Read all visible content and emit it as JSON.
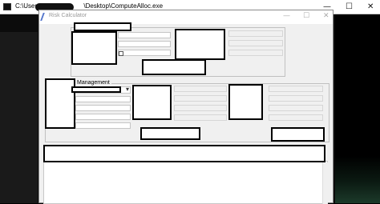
{
  "console": {
    "title_prefix": "C:\\Users\\",
    "title_suffix": "\\Desktop\\ComputeAlloc.exe",
    "minimize": "—",
    "maximize": "☐",
    "close": "✕"
  },
  "app": {
    "title": "Risk Calculator",
    "minimize": "—",
    "maximize": "☐",
    "close": "✕"
  },
  "management": {
    "label": "Management",
    "dropdown_arrow": "▾"
  }
}
